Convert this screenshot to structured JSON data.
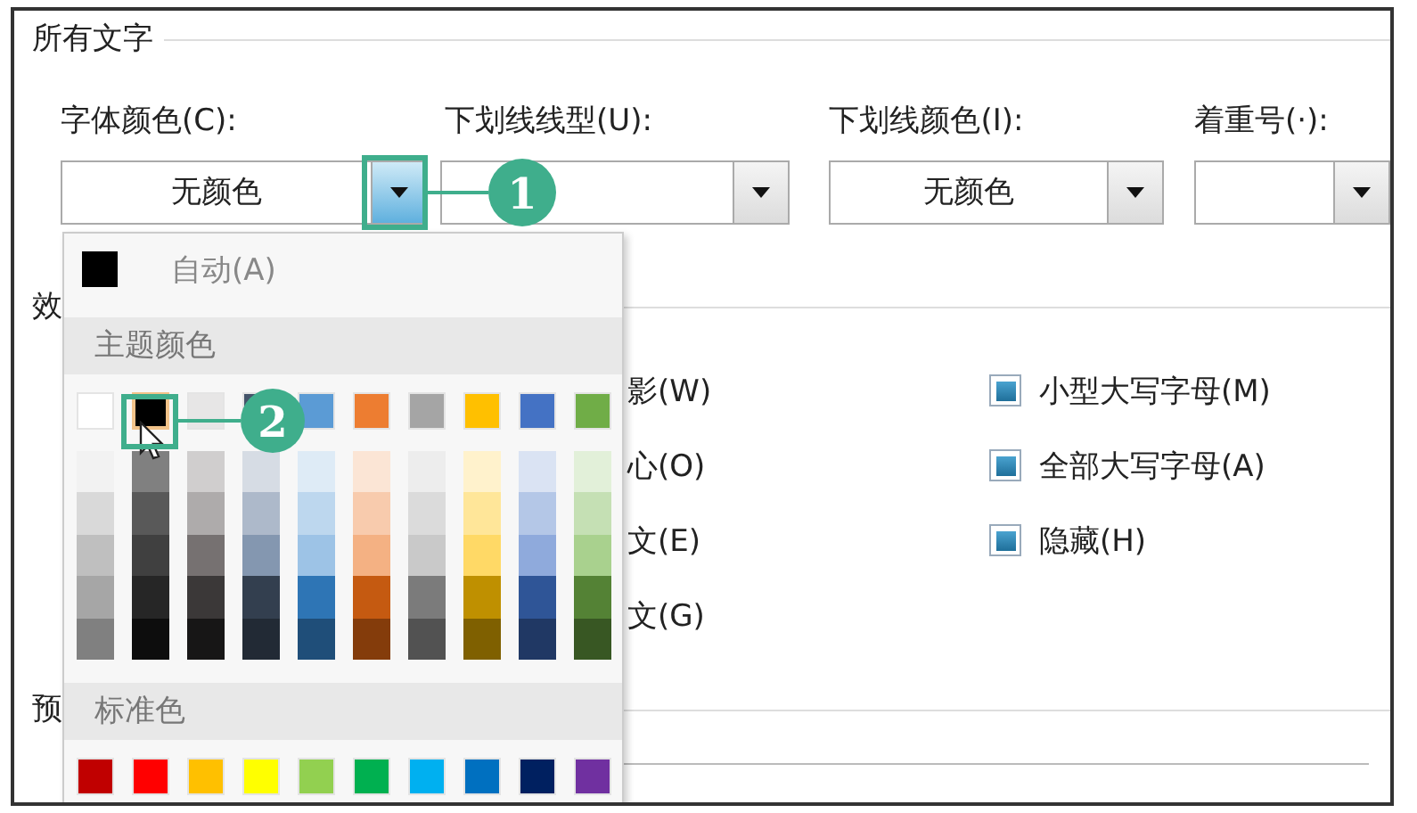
{
  "group_title": "所有文字",
  "combos": [
    {
      "label": "字体颜色(C):",
      "value": "无颜色",
      "open": true
    },
    {
      "label": "下划线线型(U):",
      "open": false
    },
    {
      "label": "下划线颜色(I):",
      "value": "无颜色",
      "open": false
    },
    {
      "label": "着重号(·):",
      "open": false
    }
  ],
  "effects": {
    "title": "效",
    "left_items": [
      {
        "label": "影(W)"
      },
      {
        "label": "心(O)"
      },
      {
        "label": "文(E)"
      },
      {
        "label": "文(G)"
      }
    ],
    "right_items": [
      {
        "label": "小型大写字母(M)",
        "mixed": true
      },
      {
        "label": "全部大写字母(A)",
        "mixed": true
      },
      {
        "label": "隐藏(H)",
        "mixed": true
      }
    ]
  },
  "preview": {
    "title": "预"
  },
  "color_menu": {
    "auto": {
      "label": "自动(A)",
      "color": "#000000"
    },
    "theme_title": "主题颜色",
    "theme": [
      {
        "color": "#ffffff",
        "selected": false
      },
      {
        "color": "#000000",
        "selected": true
      },
      {
        "color": "#e7e6e6",
        "selected": false
      },
      {
        "color": "#44546a",
        "selected": false
      },
      {
        "color": "#5b9bd5",
        "selected": false
      },
      {
        "color": "#ed7d31",
        "selected": false
      },
      {
        "color": "#a5a5a5",
        "selected": false
      },
      {
        "color": "#ffc000",
        "selected": false
      },
      {
        "color": "#4472c4",
        "selected": false
      },
      {
        "color": "#70ad47",
        "selected": false
      }
    ],
    "shades": [
      {
        "cells": [
          {
            "color": "#f2f2f2"
          },
          {
            "color": "#d9d9d9"
          },
          {
            "color": "#bfbfbf"
          },
          {
            "color": "#a6a6a6"
          },
          {
            "color": "#808080"
          }
        ]
      },
      {
        "cells": [
          {
            "color": "#808080"
          },
          {
            "color": "#595959"
          },
          {
            "color": "#404040"
          },
          {
            "color": "#262626"
          },
          {
            "color": "#0d0d0d"
          }
        ]
      },
      {
        "cells": [
          {
            "color": "#d0cece"
          },
          {
            "color": "#aeabab"
          },
          {
            "color": "#767171"
          },
          {
            "color": "#3b3838"
          },
          {
            "color": "#171616"
          }
        ]
      },
      {
        "cells": [
          {
            "color": "#d6dce4"
          },
          {
            "color": "#adb9ca"
          },
          {
            "color": "#8497b0"
          },
          {
            "color": "#333f4f"
          },
          {
            "color": "#222a35"
          }
        ]
      },
      {
        "cells": [
          {
            "color": "#deebf6"
          },
          {
            "color": "#bdd7ee"
          },
          {
            "color": "#9dc3e6"
          },
          {
            "color": "#2e75b5"
          },
          {
            "color": "#1f4e79"
          }
        ]
      },
      {
        "cells": [
          {
            "color": "#fbe5d5"
          },
          {
            "color": "#f8cbad"
          },
          {
            "color": "#f4b183"
          },
          {
            "color": "#c55a11"
          },
          {
            "color": "#843c0b"
          }
        ]
      },
      {
        "cells": [
          {
            "color": "#ededed"
          },
          {
            "color": "#dbdbdb"
          },
          {
            "color": "#c9c9c9"
          },
          {
            "color": "#7b7b7b"
          },
          {
            "color": "#525252"
          }
        ]
      },
      {
        "cells": [
          {
            "color": "#fff2cc"
          },
          {
            "color": "#ffe699"
          },
          {
            "color": "#ffd966"
          },
          {
            "color": "#bf9000"
          },
          {
            "color": "#7f6000"
          }
        ]
      },
      {
        "cells": [
          {
            "color": "#dae3f3"
          },
          {
            "color": "#b4c7e7"
          },
          {
            "color": "#8faadc"
          },
          {
            "color": "#2f5597"
          },
          {
            "color": "#203864"
          }
        ]
      },
      {
        "cells": [
          {
            "color": "#e2f0d9"
          },
          {
            "color": "#c5e0b4"
          },
          {
            "color": "#a9d18e"
          },
          {
            "color": "#548235"
          },
          {
            "color": "#385723"
          }
        ]
      }
    ],
    "standard_title": "标准色",
    "standard": [
      {
        "color": "#c00000"
      },
      {
        "color": "#ff0000"
      },
      {
        "color": "#ffc000"
      },
      {
        "color": "#ffff00"
      },
      {
        "color": "#92d050"
      },
      {
        "color": "#00b050"
      },
      {
        "color": "#00b0f0"
      },
      {
        "color": "#0070c0"
      },
      {
        "color": "#002060"
      },
      {
        "color": "#7030a0"
      }
    ]
  },
  "callouts": [
    {
      "label": "1"
    },
    {
      "label": "2"
    }
  ]
}
